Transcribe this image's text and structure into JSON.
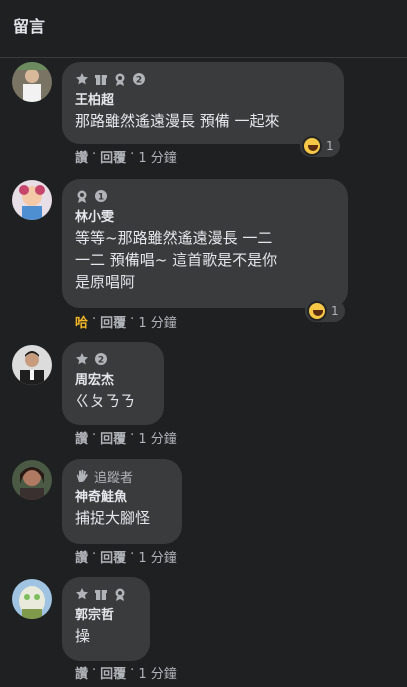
{
  "header": {
    "title": "留言"
  },
  "comments": [
    {
      "name": "王柏超",
      "text": "那路雖然遙遠漫長 預備 一起來",
      "badges": [
        "rising-star-icon",
        "gift-icon",
        "medal-icon",
        "level-2-icon"
      ],
      "reaction": {
        "count": "1"
      },
      "actions": {
        "like": "讚",
        "reply": "回覆",
        "time": "1 分鐘"
      }
    },
    {
      "name": "林小雯",
      "text": "等等~那路雖然遙遠漫長 一二\n一二 預備唱~ 這首歌是不是你\n是原唱阿",
      "badges": [
        "medal-icon",
        "level-1-icon"
      ],
      "reaction": {
        "count": "1"
      },
      "actions": {
        "like": "哈",
        "reply": "回覆",
        "time": "1 分鐘"
      }
    },
    {
      "name": "周宏杰",
      "text": "ㄍㄆㄋㄋ",
      "badges": [
        "rising-star-icon",
        "level-2-icon"
      ],
      "actions": {
        "like": "讚",
        "reply": "回覆",
        "time": "1 分鐘"
      }
    },
    {
      "name": "神奇鮭魚",
      "text": "捕捉大腳怪",
      "badge_label": "追蹤者",
      "badges": [
        "wave-icon"
      ],
      "actions": {
        "like": "讚",
        "reply": "回覆",
        "time": "1 分鐘"
      }
    },
    {
      "name": "郭宗哲",
      "text": "操",
      "badges": [
        "rising-star-icon",
        "gift-icon",
        "medal-icon"
      ],
      "actions": {
        "like": "讚",
        "reply": "回覆",
        "time": "1 分鐘"
      }
    }
  ],
  "separator": "·",
  "colors": {
    "background": "#1f2022",
    "bubble": "#3a3b3c",
    "haha_highlight": "#f7b928"
  }
}
